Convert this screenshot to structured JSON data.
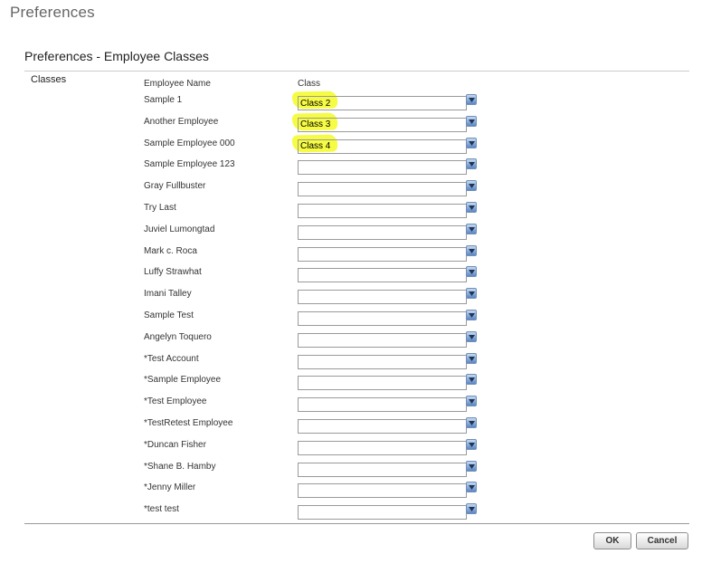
{
  "page": {
    "title": "Preferences",
    "section_title": "Preferences - Employee Classes",
    "group_label": "Classes"
  },
  "table": {
    "headers": {
      "name": "Employee Name",
      "class": "Class"
    },
    "rows": [
      {
        "name": "Sample 1",
        "class": "Class 2",
        "highlighted": true
      },
      {
        "name": "Another Employee",
        "class": "Class 3",
        "highlighted": true
      },
      {
        "name": "Sample Employee 000",
        "class": "Class 4",
        "highlighted": true
      },
      {
        "name": "Sample Employee 123",
        "class": ""
      },
      {
        "name": "Gray Fullbuster",
        "class": ""
      },
      {
        "name": "Try Last",
        "class": ""
      },
      {
        "name": "Juviel Lumongtad",
        "class": ""
      },
      {
        "name": "Mark c. Roca",
        "class": ""
      },
      {
        "name": "Luffy Strawhat",
        "class": ""
      },
      {
        "name": "Imani Talley",
        "class": ""
      },
      {
        "name": "Sample Test",
        "class": ""
      },
      {
        "name": "Angelyn Toquero",
        "class": ""
      },
      {
        "name": "*Test Account",
        "class": ""
      },
      {
        "name": "*Sample Employee",
        "class": ""
      },
      {
        "name": "*Test Employee",
        "class": ""
      },
      {
        "name": "*TestRetest Employee",
        "class": ""
      },
      {
        "name": "*Duncan Fisher",
        "class": ""
      },
      {
        "name": "*Shane B. Hamby",
        "class": ""
      },
      {
        "name": "*Jenny Miller",
        "class": ""
      },
      {
        "name": "*test test",
        "class": ""
      }
    ]
  },
  "buttons": {
    "ok": "OK",
    "cancel": "Cancel"
  },
  "icons": {
    "dropdown": "chevron-down-icon"
  },
  "colors": {
    "highlight": "#f6fb3a",
    "dropdown_button": "#5d86c4"
  }
}
